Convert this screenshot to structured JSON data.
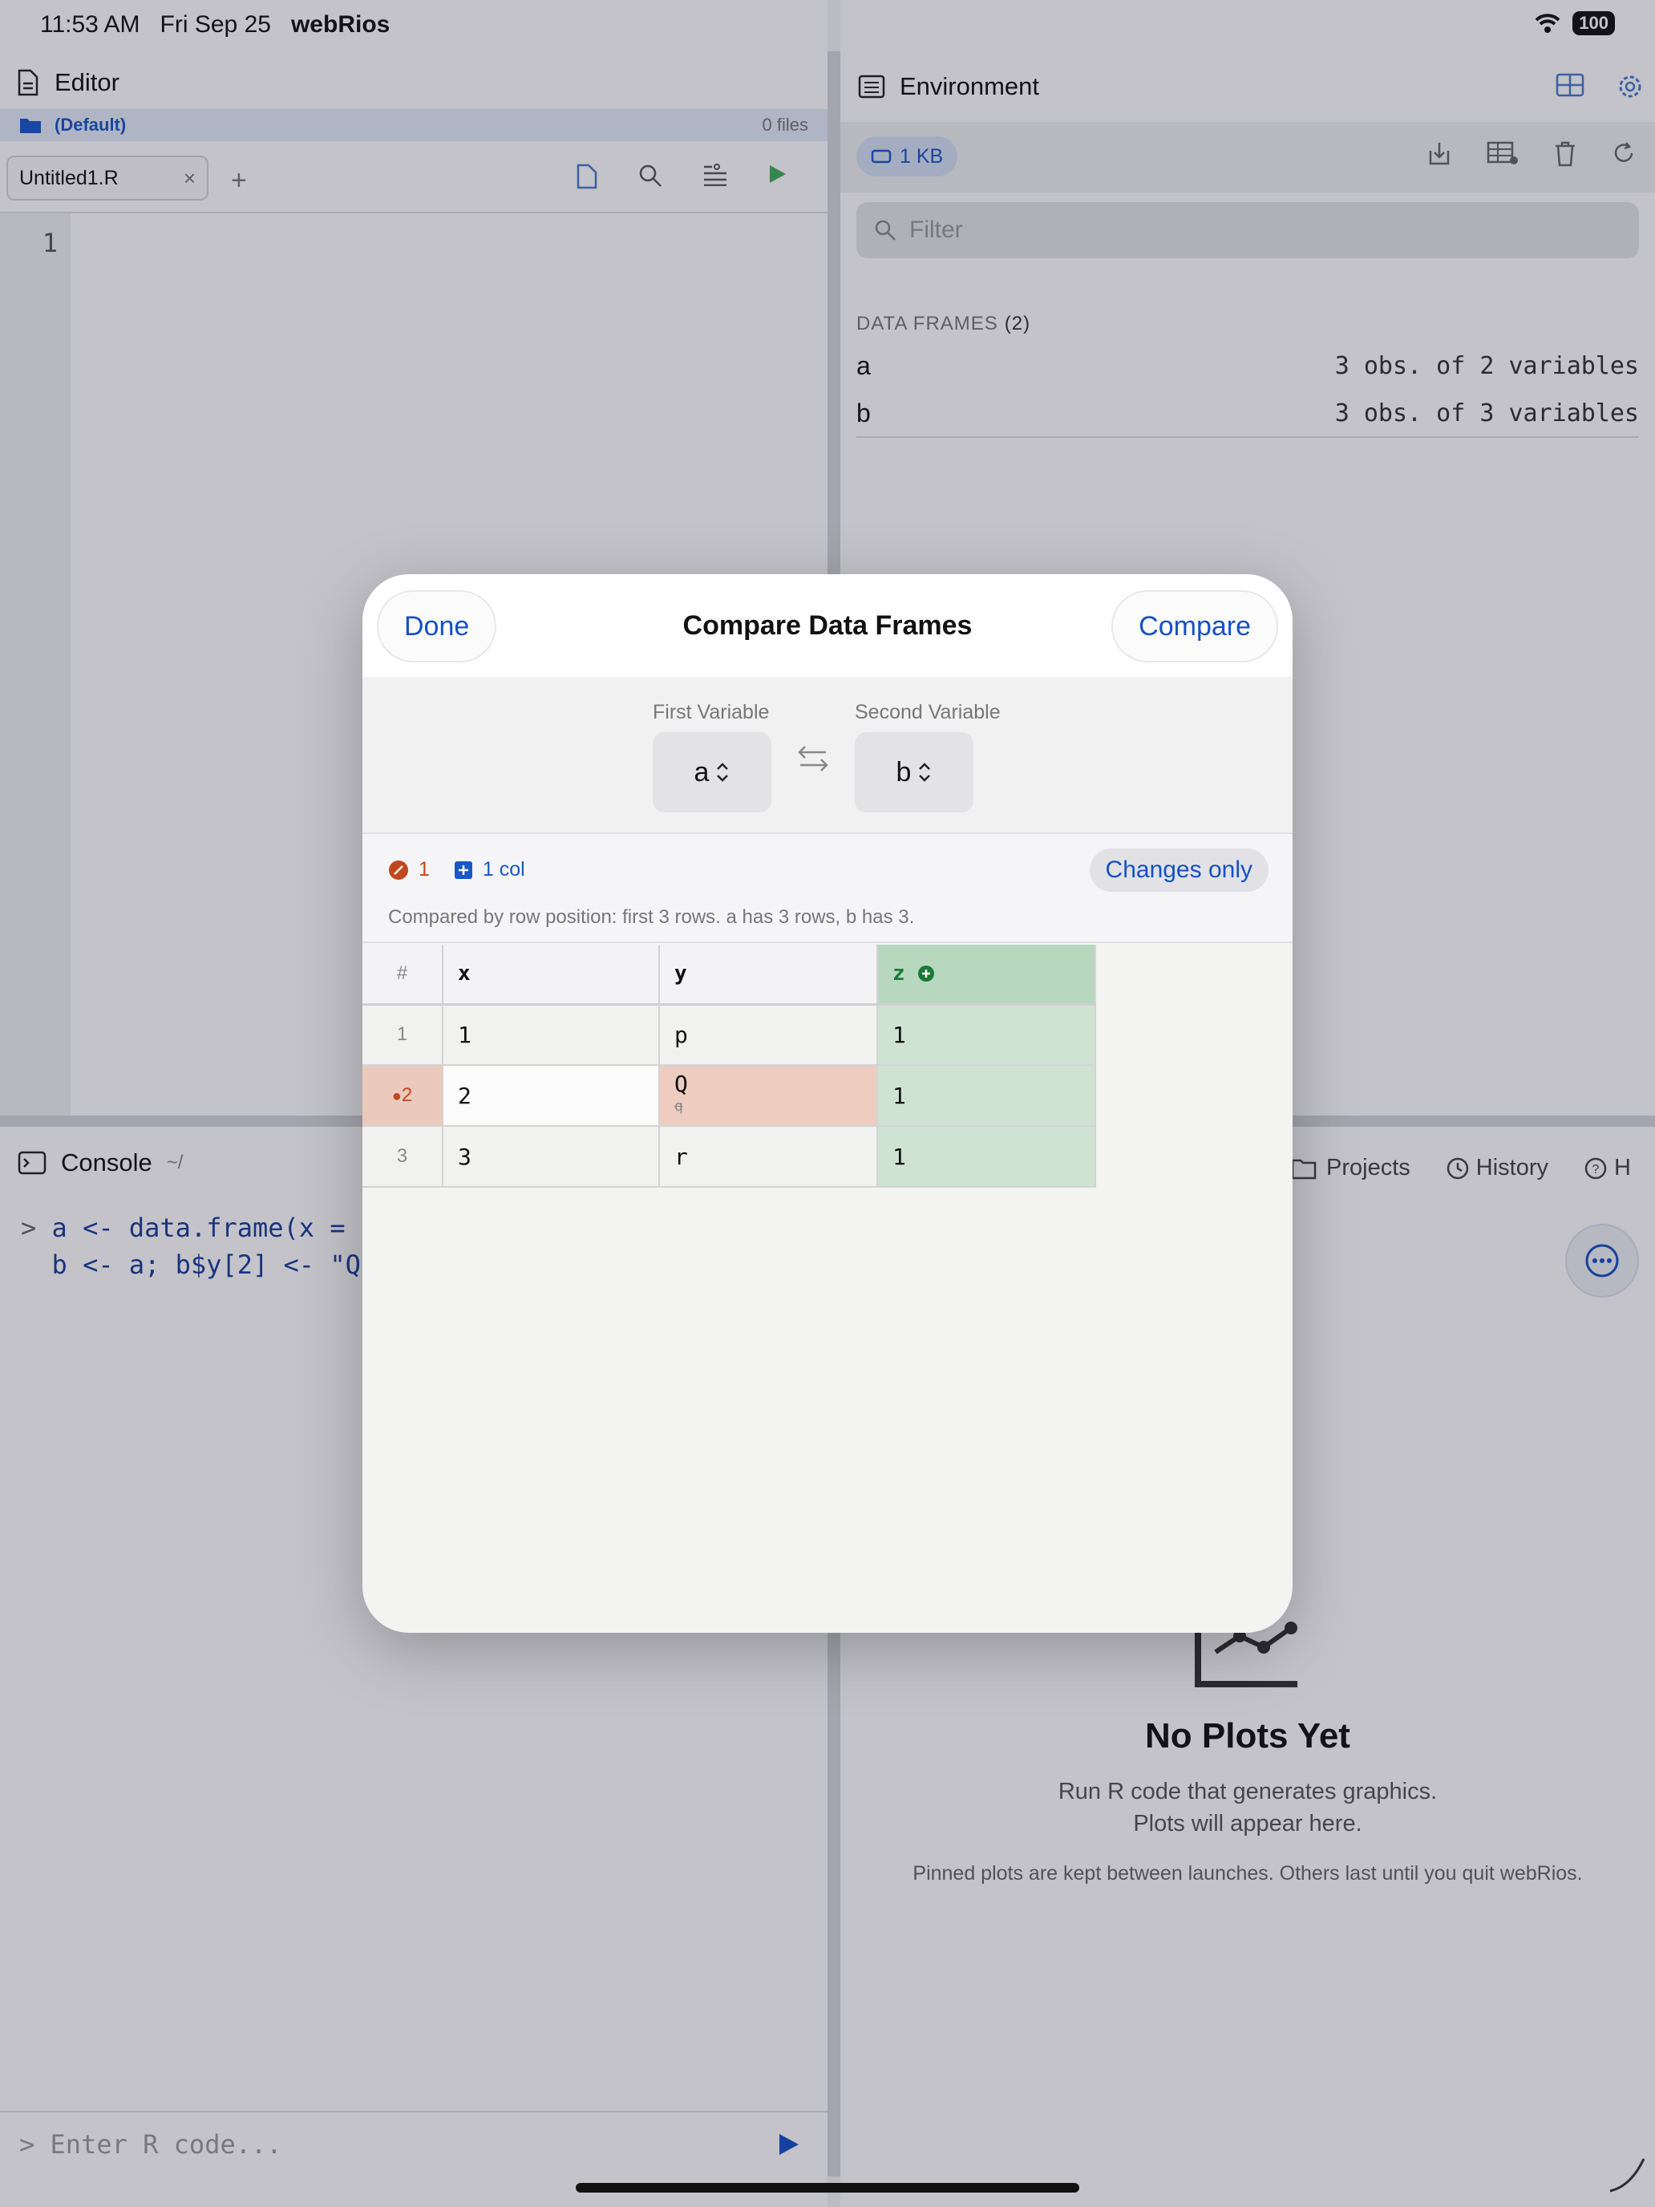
{
  "status_bar": {
    "time": "11:53 AM",
    "date": "Fri Sep 25",
    "app": "webRios",
    "battery": "100"
  },
  "editor": {
    "title": "Editor",
    "project_name": "(Default)",
    "files_count": "0 files",
    "tab_label": "Untitled1.R",
    "tab_close": "×",
    "add_tab": "+",
    "line_number": "1"
  },
  "environment": {
    "title": "Environment",
    "memory": "1 KB",
    "filter_placeholder": "Filter",
    "section_label": "DATA FRAMES",
    "section_count": "(2)",
    "frames": [
      {
        "name": "a",
        "desc": "3 obs. of 2 variables"
      },
      {
        "name": "b",
        "desc": "3 obs. of 3 variables"
      }
    ]
  },
  "console": {
    "title": "Console",
    "path": "~/",
    "prompt": ">",
    "line1": "a <- data.frame(x =",
    "line2": "b <- a; b$y[2] <- \"Q",
    "input_placeholder": "Enter R code..."
  },
  "bottom_panel": {
    "tabs": [
      "Projects",
      "History",
      "H"
    ],
    "no_plots_title": "No Plots Yet",
    "no_plots_line1": "Run R code that generates graphics.",
    "no_plots_line2": "Plots will appear here.",
    "pinned_note": "Pinned plots are kept between launches. Others last until you quit webRios."
  },
  "modal": {
    "title": "Compare Data Frames",
    "done": "Done",
    "compare": "Compare",
    "first_label": "First Variable",
    "first_value": "a",
    "second_label": "Second Variable",
    "second_value": "b",
    "changed_count": "1",
    "added_cols": "1 col",
    "changes_only": "Changes only",
    "note": "Compared by row position: first 3 rows. a has 3 rows, b has 3.",
    "headers": {
      "num": "#",
      "x": "x",
      "y": "y",
      "z": "z"
    },
    "rows": [
      {
        "num": "1",
        "x": "1",
        "y": "p",
        "z": "1"
      },
      {
        "num": "2",
        "x": "2",
        "y": "Q",
        "y_old": "q",
        "z": "1"
      },
      {
        "num": "3",
        "x": "3",
        "y": "r",
        "z": "1"
      }
    ]
  },
  "colors": {
    "accent": "#1650c4",
    "changed": "#c3461e",
    "added": "#1a7a35"
  }
}
